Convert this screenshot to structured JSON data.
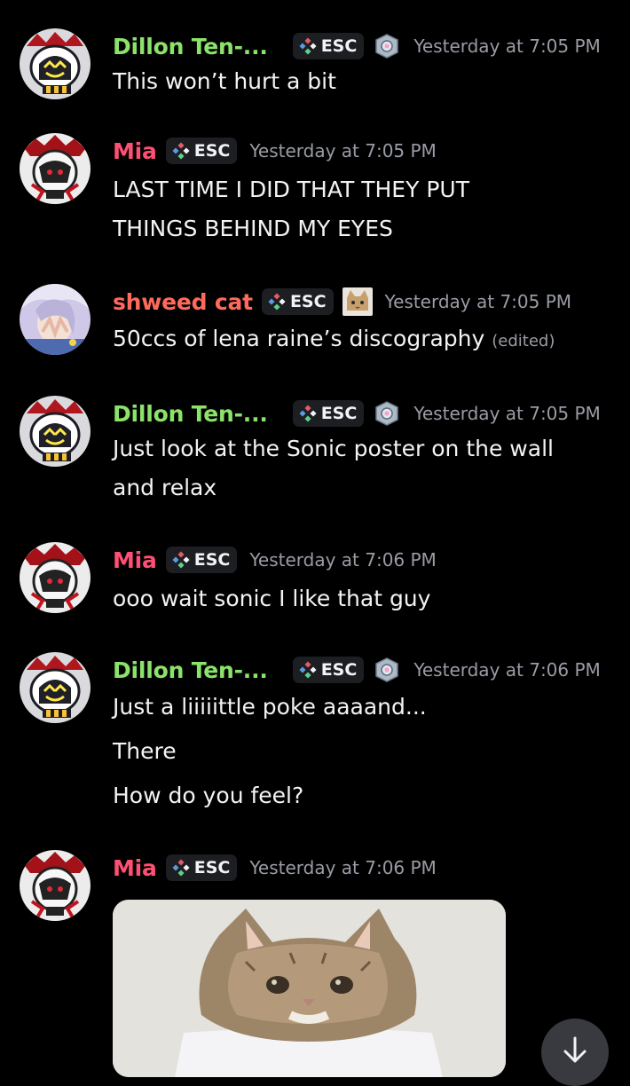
{
  "colors": {
    "background": "#000000",
    "dillon": "#8be36a",
    "mia": "#ff4f74",
    "shweed": "#ff6a5c",
    "timestamp": "#9a9ca5",
    "text": "#f2f3f5",
    "tag_bg": "#1d1e22"
  },
  "messages": [
    {
      "user": "Dillon Ten-...",
      "tag": "ESC",
      "badge": "cube-badge-icon",
      "time": "Yesterday at 7:05 PM",
      "lines": [
        "This won’t hurt a bit"
      ]
    },
    {
      "user": "Mia",
      "tag": "ESC",
      "time": "Yesterday at 7:05 PM",
      "lines": [
        "LAST TIME I DID THAT THEY PUT",
        "THINGS BEHIND MY EYES"
      ]
    },
    {
      "user": "shweed cat",
      "tag": "ESC",
      "badge": "cat-badge-icon",
      "time": "Yesterday at 7:05 PM",
      "lines": [
        "50ccs of lena raine’s discography"
      ],
      "edited": "(edited)"
    },
    {
      "user": "Dillon Ten-...",
      "tag": "ESC",
      "badge": "cube-badge-icon",
      "time": "Yesterday at 7:05 PM",
      "lines": [
        "Just look at the Sonic poster on the wall",
        "and relax"
      ]
    },
    {
      "user": "Mia",
      "tag": "ESC",
      "time": "Yesterday at 7:06 PM",
      "lines": [
        "ooo wait sonic I like that guy"
      ]
    },
    {
      "user": "Dillon Ten-...",
      "tag": "ESC",
      "badge": "cube-badge-icon",
      "time": "Yesterday at 7:06 PM",
      "lines": [
        "Just a liiiiittle poke aaaand...",
        "There",
        "How do you feel?"
      ]
    },
    {
      "user": "Mia",
      "tag": "ESC",
      "time": "Yesterday at 7:06 PM",
      "attachment": "cat-image"
    }
  ]
}
